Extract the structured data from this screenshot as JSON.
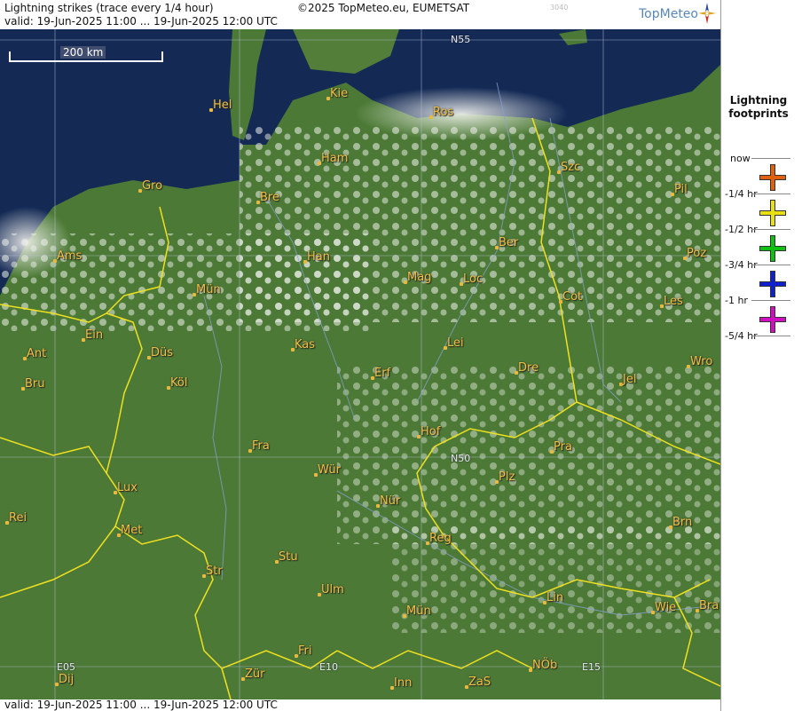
{
  "header": {
    "title": "Lightning strikes (trace every 1/4 hour)",
    "copyright": "©2025 TopMeteo.eu, EUMETSAT",
    "valid": "valid:  19-Jun-2025 11:00 ... 19-Jun-2025 12:00 UTC",
    "code": "3040",
    "brand": "TopMeteo"
  },
  "footer": {
    "valid": "valid:  19-Jun-2025 11:00 ... 19-Jun-2025 12:00 UTC"
  },
  "map": {
    "scale_label": "200 km",
    "grid_labels": [
      "N55",
      "N50",
      "E05",
      "E10",
      "E15"
    ],
    "cities": [
      "Hel",
      "Kie",
      "Ros",
      "Ham",
      "Szc",
      "Gro",
      "Bre",
      "Pil",
      "Ber",
      "Ams",
      "Han",
      "Poz",
      "Mag",
      "Loc",
      "Mün",
      "Cot",
      "Les",
      "Ein",
      "Kas",
      "Lei",
      "Ant",
      "Düs",
      "Wro",
      "Erf",
      "Dre",
      "Bru",
      "Köl",
      "Jel",
      "Hof",
      "Fra",
      "Pra",
      "Wür",
      "Plz",
      "Lux",
      "Nür",
      "Rei",
      "Met",
      "Reg",
      "Brn",
      "Stu",
      "Str",
      "Ulm",
      "Lin",
      "Wie",
      "Bra",
      "Mün",
      "Fri",
      "Zür",
      "Dij",
      "Inn",
      "ZaS",
      "NÖb"
    ]
  },
  "legend": {
    "title_line1": "Lightning",
    "title_line2": "footprints",
    "items": [
      {
        "label": "now",
        "color": "#e06010"
      },
      {
        "label": "-1/4 hr",
        "color": "#e8e010"
      },
      {
        "label": "-1/2 hr",
        "color": "#10c010"
      },
      {
        "label": "-3/4 hr",
        "color": "#1020d0"
      },
      {
        "label": "-1 hr",
        "color": "#d010c0"
      },
      {
        "label": "-5/4 hr",
        "color": ""
      }
    ]
  },
  "colors": {
    "sea": "#142850",
    "land": "#4a7a34",
    "border": "#f2e020",
    "city": "#f0c040"
  }
}
